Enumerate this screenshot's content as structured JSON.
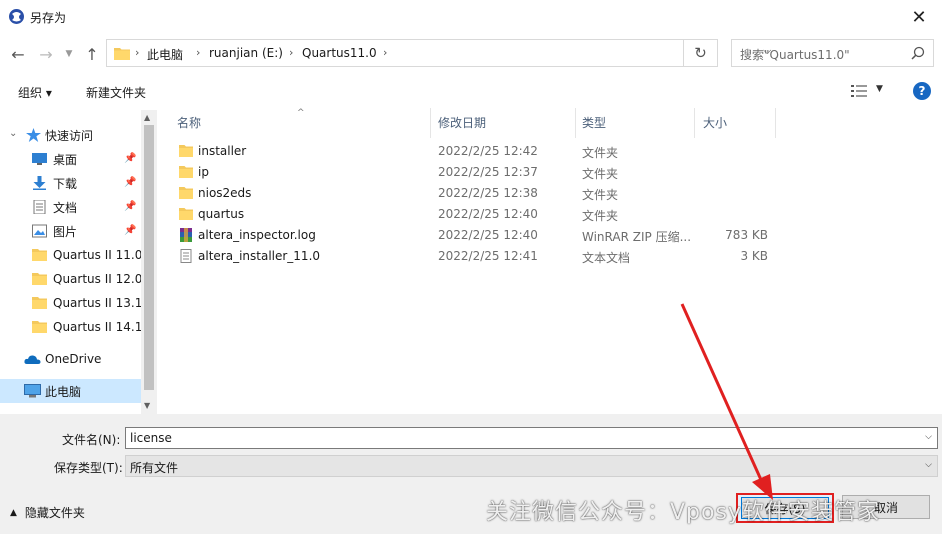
{
  "window": {
    "title": "另存为",
    "close_label": "✕"
  },
  "address": {
    "crumbs": [
      "此电脑",
      "ruanjian (E:)",
      "Quartus11.0"
    ],
    "search_placeholder": "搜索\"Quartus11.0\""
  },
  "toolbar": {
    "organize": "组织 ▾",
    "new_folder": "新建文件夹",
    "help": "?"
  },
  "sidebar": {
    "items": [
      {
        "label": "快速访问",
        "icon": "star-icon"
      },
      {
        "label": "桌面",
        "icon": "desktop-icon",
        "pinned": true
      },
      {
        "label": "下载",
        "icon": "download-icon",
        "pinned": true
      },
      {
        "label": "文档",
        "icon": "document-icon",
        "pinned": true
      },
      {
        "label": "图片",
        "icon": "picture-icon",
        "pinned": true
      },
      {
        "label": "Quartus II 11.0",
        "icon": "folder-icon"
      },
      {
        "label": "Quartus II 12.0",
        "icon": "folder-icon"
      },
      {
        "label": "Quartus II 13.1",
        "icon": "folder-icon"
      },
      {
        "label": "Quartus II 14.1",
        "icon": "folder-icon"
      },
      {
        "label": "OneDrive",
        "icon": "cloud-icon"
      },
      {
        "label": "此电脑",
        "icon": "computer-icon",
        "selected": true
      }
    ]
  },
  "columns": {
    "name": "名称",
    "date": "修改日期",
    "type": "类型",
    "size": "大小"
  },
  "files": [
    {
      "name": "installer",
      "date": "2022/2/25 12:42",
      "type": "文件夹",
      "size": "",
      "icon": "folder-icon"
    },
    {
      "name": "ip",
      "date": "2022/2/25 12:37",
      "type": "文件夹",
      "size": "",
      "icon": "folder-icon"
    },
    {
      "name": "nios2eds",
      "date": "2022/2/25 12:38",
      "type": "文件夹",
      "size": "",
      "icon": "folder-icon"
    },
    {
      "name": "quartus",
      "date": "2022/2/25 12:40",
      "type": "文件夹",
      "size": "",
      "icon": "folder-icon"
    },
    {
      "name": "altera_inspector.log",
      "date": "2022/2/25 12:40",
      "type": "WinRAR ZIP 压缩...",
      "size": "783 KB",
      "icon": "winrar-icon"
    },
    {
      "name": "altera_installer_11.0",
      "date": "2022/2/25 12:41",
      "type": "文本文档",
      "size": "3 KB",
      "icon": "text-file-icon"
    }
  ],
  "form": {
    "filename_label": "文件名(N):",
    "filename_value": "license",
    "filetype_label": "保存类型(T):",
    "filetype_value": "所有文件"
  },
  "footer": {
    "hide_folders": "隐藏文件夹",
    "save_button": "保存(S)",
    "cancel_button": "取消"
  },
  "watermark": "关注微信公众号：Vposy软件安装管家",
  "colors": {
    "accent": "#0078d7",
    "highlight_red": "#e02020",
    "selected_bg": "#cce8ff"
  }
}
